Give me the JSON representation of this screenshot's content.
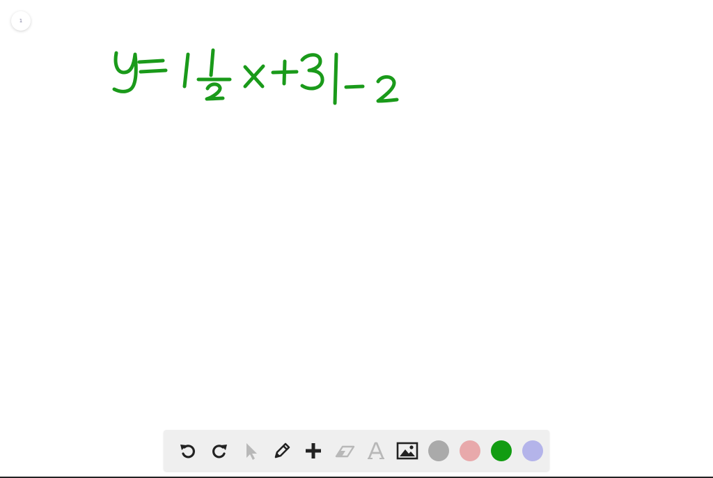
{
  "page_indicator": {
    "number": "1"
  },
  "handwriting": {
    "expression": "y=|½x+3|-2",
    "ink_color": "#1a9a1a"
  },
  "toolbar": {
    "tools": [
      {
        "name": "undo",
        "icon": "undo-icon",
        "enabled": true
      },
      {
        "name": "redo",
        "icon": "redo-icon",
        "enabled": true
      },
      {
        "name": "select",
        "icon": "cursor-arrow-icon",
        "enabled": false
      },
      {
        "name": "pen",
        "icon": "pencil-icon",
        "enabled": true
      },
      {
        "name": "add",
        "icon": "plus-icon",
        "enabled": true
      },
      {
        "name": "eraser",
        "icon": "eraser-icon",
        "enabled": false
      },
      {
        "name": "text",
        "icon": "text-a-icon",
        "enabled": false
      },
      {
        "name": "image",
        "icon": "image-icon",
        "enabled": true
      }
    ],
    "colors": [
      {
        "name": "gray",
        "hex": "#aaaaaa"
      },
      {
        "name": "pink",
        "hex": "#e8a9ab"
      },
      {
        "name": "green",
        "hex": "#129c12"
      },
      {
        "name": "lavender",
        "hex": "#b4b4ea"
      }
    ],
    "icon_color": "#222222",
    "disabled_icon_color": "#b8b8b8"
  }
}
